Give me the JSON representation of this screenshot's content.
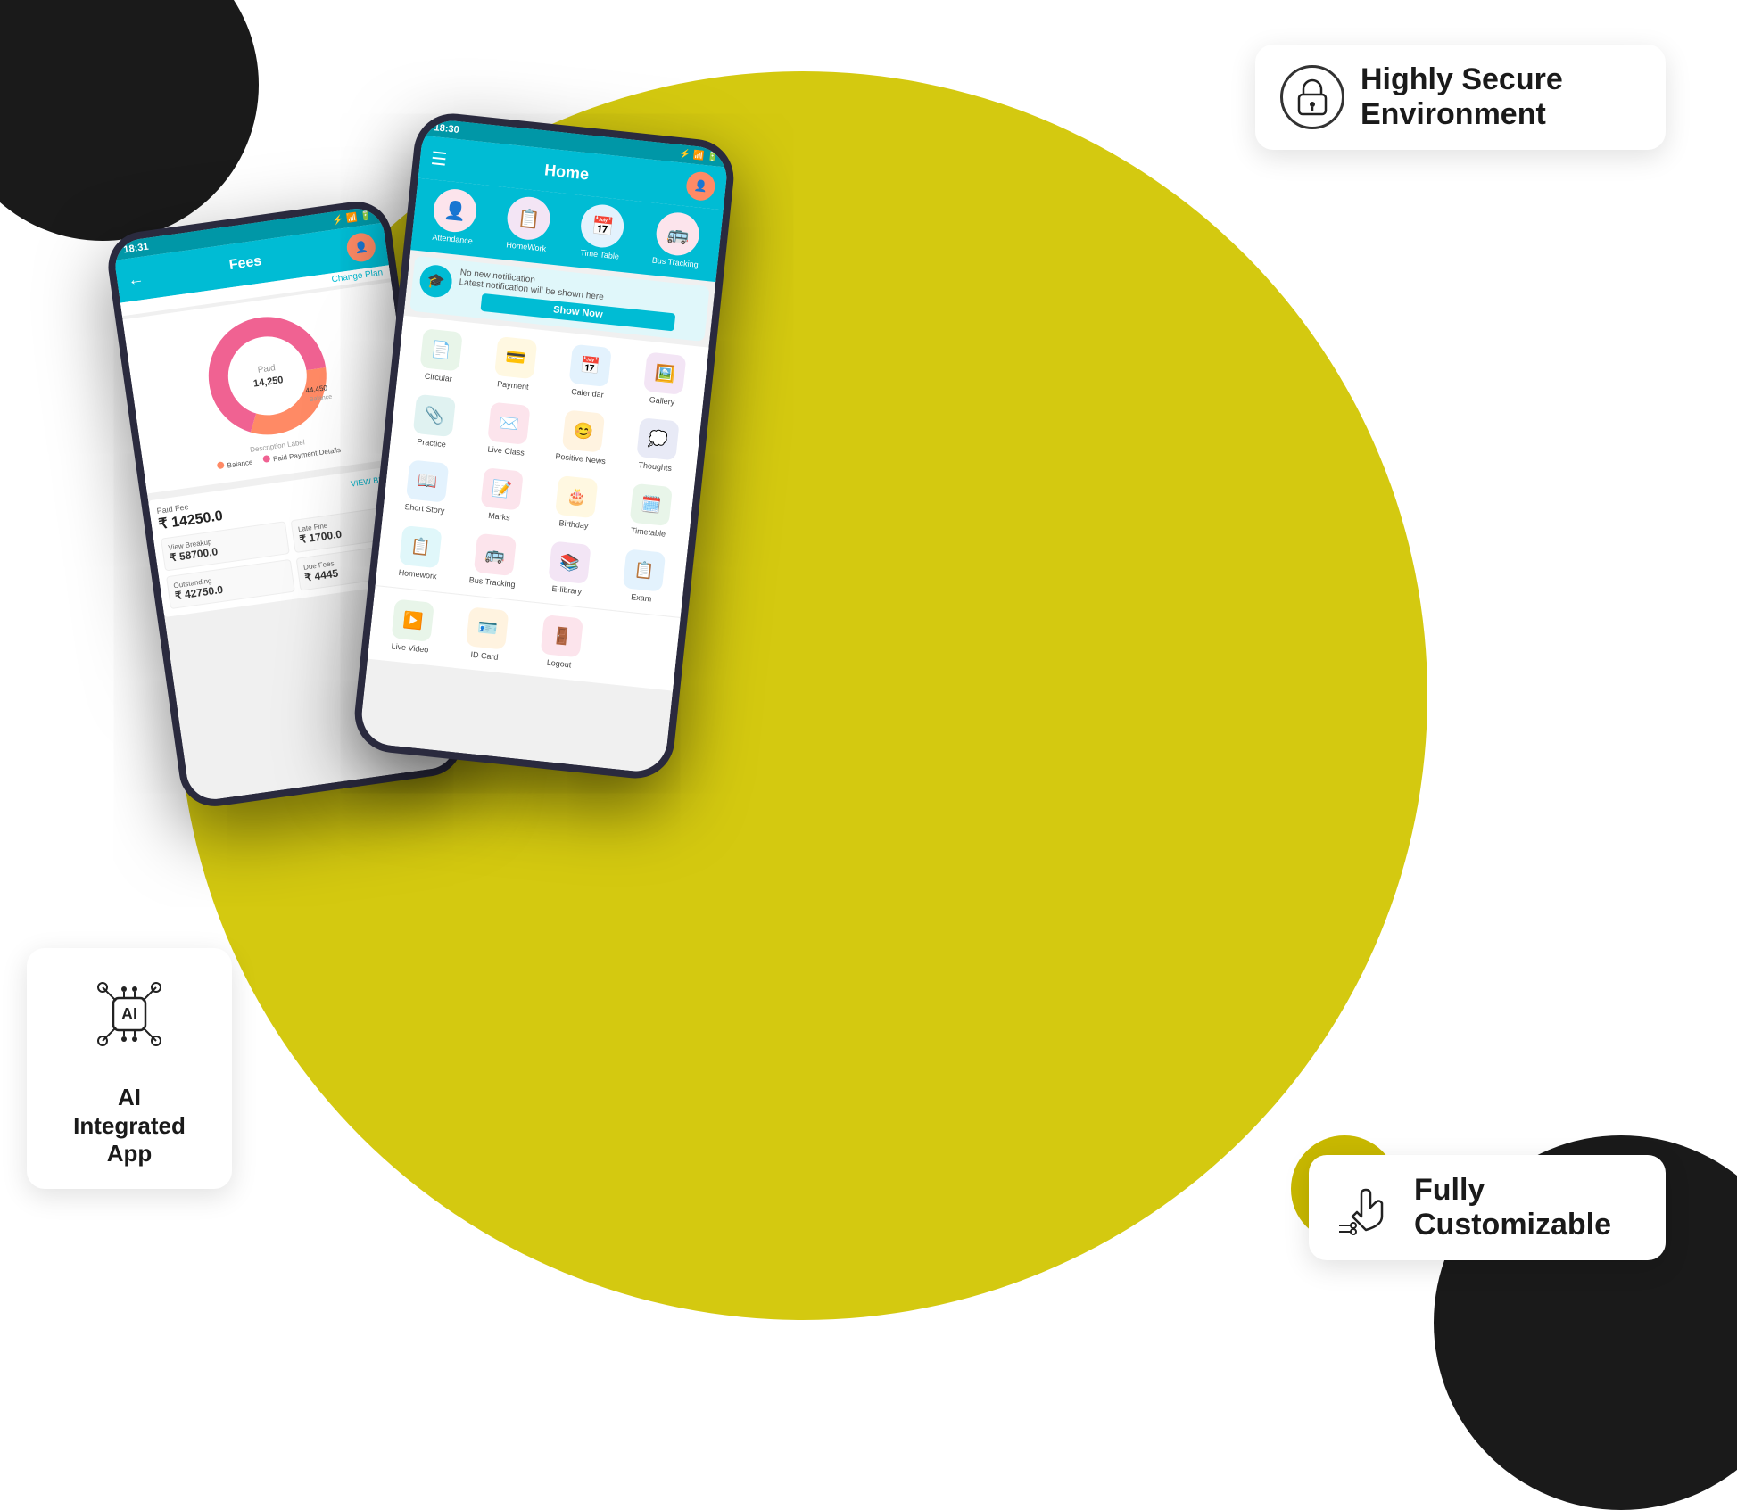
{
  "background": {
    "main_circle_color": "#d4c910",
    "dark_color": "#1a1a1a"
  },
  "feature_cards": {
    "secure": {
      "title": "Highly Secure",
      "subtitle": "Environment",
      "icon": "🔒"
    },
    "ai": {
      "title": "AI",
      "subtitle_line1": "AI",
      "subtitle_line2": "Integrated",
      "subtitle_line3": "App"
    },
    "customizable": {
      "title_line1": "Fully",
      "title_line2": "Customizable"
    }
  },
  "phone1": {
    "status_time": "18:31",
    "header_title": "Fees",
    "header_action": "Change Plan",
    "legend_balance": "Balance",
    "legend_paid": "Paid Payment Details",
    "paid_fee_label": "Paid Fee",
    "paid_fee_amount": "₹ 14250.0",
    "view_breakup": "VIEW BREAKUP",
    "cards": [
      {
        "label": "View Breakup",
        "amount": "₹ 58700.0"
      },
      {
        "label": "Late Fine",
        "amount": "₹ 1700.0"
      },
      {
        "label": "Outstanding",
        "amount": "₹ 42750.0"
      },
      {
        "label": "Due Fees",
        "amount": "₹ 4445"
      }
    ],
    "chart": {
      "paid_label": "Paid",
      "paid_value": "14,250",
      "balance_value": "44,450",
      "balance_label": "Balance",
      "desc_label": "Description Label"
    }
  },
  "phone2": {
    "status_time": "18:30",
    "header_title": "Home",
    "notification": {
      "line1": "No new notification",
      "line2": "Latest notification will be shown here",
      "button": "Show Now"
    },
    "quick_icons": [
      {
        "label": "Attendance",
        "icon": "👤",
        "color_class": "ic-attendance"
      },
      {
        "label": "HomeWork",
        "icon": "📋",
        "color_class": "ic-homework"
      },
      {
        "label": "Time Table",
        "icon": "📅",
        "color_class": "ic-timetable"
      },
      {
        "label": "Bus Tracking",
        "icon": "🚌",
        "color_class": "ic-bustracking"
      }
    ],
    "menu_items": [
      {
        "label": "Circular",
        "icon": "📄",
        "color_class": "ic-circular"
      },
      {
        "label": "Payment",
        "icon": "💳",
        "color_class": "ic-payment"
      },
      {
        "label": "Calendar",
        "icon": "📅",
        "color_class": "ic-calendar"
      },
      {
        "label": "Gallery",
        "icon": "🖼️",
        "color_class": "ic-gallery"
      },
      {
        "label": "Practice",
        "icon": "📎",
        "color_class": "ic-practice"
      },
      {
        "label": "Live Class",
        "icon": "✉️",
        "color_class": "ic-liveclass"
      },
      {
        "label": "Positive News",
        "icon": "😊",
        "color_class": "ic-positivenews"
      },
      {
        "label": "Thoughts",
        "icon": "💭",
        "color_class": "ic-thoughts"
      },
      {
        "label": "Short Story",
        "icon": "📖",
        "color_class": "ic-shortstory"
      },
      {
        "label": "Marks",
        "icon": "📝",
        "color_class": "ic-marks"
      },
      {
        "label": "Birthday",
        "icon": "🎂",
        "color_class": "ic-birthday"
      },
      {
        "label": "Timetable",
        "icon": "🗓️",
        "color_class": "ic-timetable2"
      },
      {
        "label": "Homework",
        "icon": "📋",
        "color_class": "ic-homeworkbottom"
      },
      {
        "label": "Bus Tracking",
        "icon": "🚌",
        "color_class": "ic-bustracking2"
      },
      {
        "label": "E-library",
        "icon": "📚",
        "color_class": "ic-elibrary"
      },
      {
        "label": "Exam",
        "icon": "📋",
        "color_class": "ic-exam"
      }
    ]
  }
}
